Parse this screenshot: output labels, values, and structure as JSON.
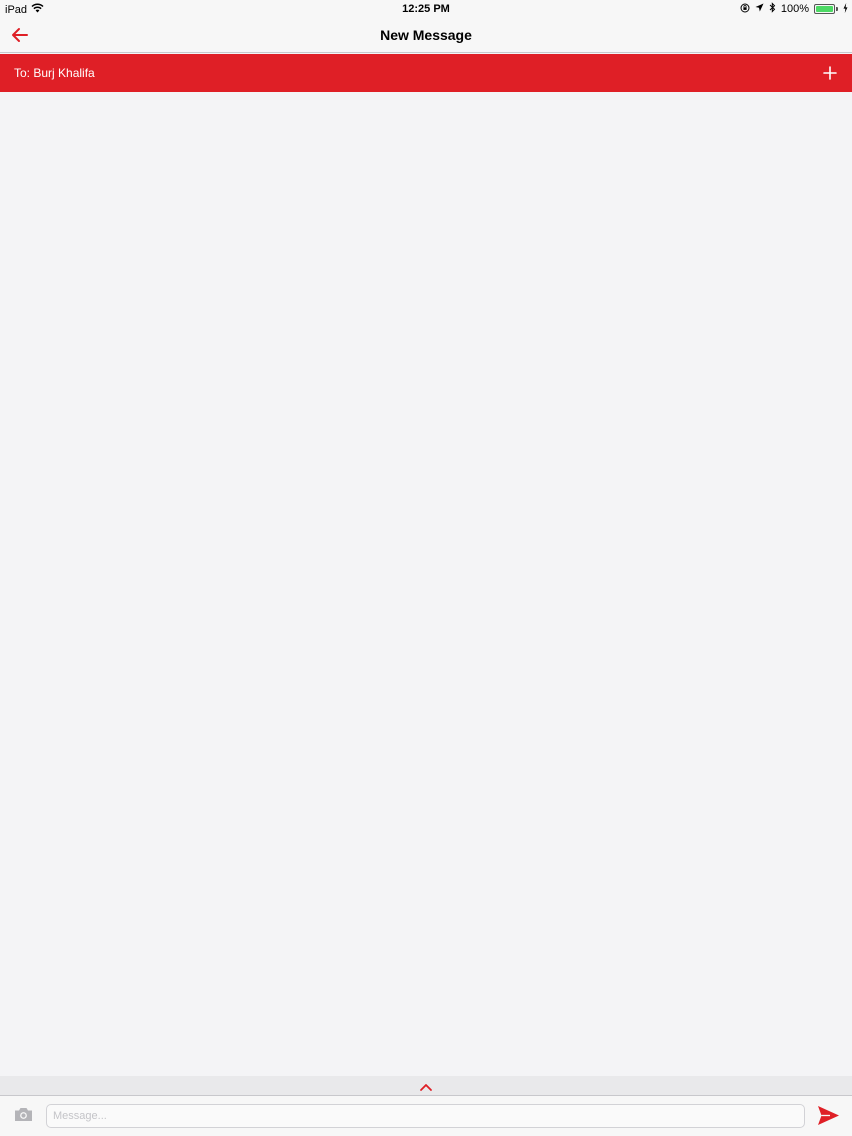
{
  "status_bar": {
    "device": "iPad",
    "time": "12:25 PM",
    "battery_percent": "100%",
    "battery_level": 1.0,
    "icons": [
      "wifi-icon",
      "orientation-lock-icon",
      "location-icon",
      "bluetooth-icon",
      "battery-icon",
      "charging-icon"
    ]
  },
  "nav": {
    "title": "New Message",
    "back_icon": "arrow-left-icon"
  },
  "recipient": {
    "label": "To: Burj Khalifa",
    "add_icon": "plus-icon"
  },
  "expand": {
    "icon": "chevron-up-icon"
  },
  "composer": {
    "placeholder": "Message...",
    "value": "",
    "camera_icon": "camera-icon",
    "send_icon": "send-icon"
  },
  "colors": {
    "accent": "#df1f26",
    "background": "#f4f4f6",
    "battery_green": "#4cd964"
  }
}
